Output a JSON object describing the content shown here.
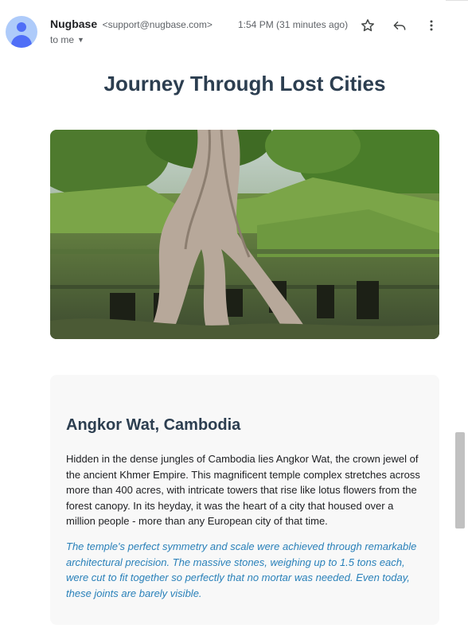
{
  "header": {
    "sender_name": "Nugbase",
    "sender_email": "<support@nugbase.com>",
    "recipient": "to me",
    "timestamp": "1:54 PM (31 minutes ago)"
  },
  "email": {
    "title": "Journey Through Lost Cities",
    "section": {
      "heading": "Angkor Wat, Cambodia",
      "paragraph": "Hidden in the dense jungles of Cambodia lies Angkor Wat, the crown jewel of the ancient Khmer Empire. This magnificent temple complex stretches across more than 400 acres, with intricate towers that rise like lotus flowers from the forest canopy. In its heyday, it was the heart of a city that housed over a million people - more than any European city of that time.",
      "quote": "The temple's perfect symmetry and scale were achieved through remarkable architectural precision. The massive stones, weighing up to 1.5 tons each, were cut to fit together so perfectly that no mortar was needed. Even today, these joints are barely visible."
    }
  },
  "icons": {
    "avatar": "person-icon",
    "expand": "chevron-down-icon",
    "star": "star-icon",
    "reply": "reply-icon",
    "more": "more-vertical-icon"
  },
  "colors": {
    "title": "#2c3e50",
    "quote": "#2980b9",
    "card_background": "#f8f8f8",
    "avatar_bg": "#aecbfa",
    "avatar_fg": "#4f6ef7"
  }
}
